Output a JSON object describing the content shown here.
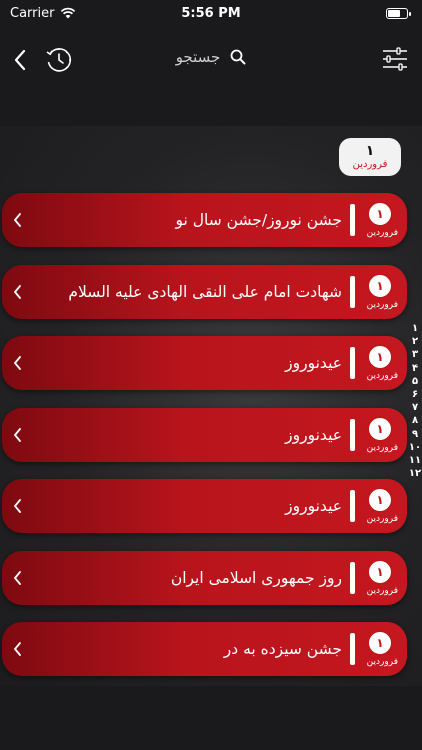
{
  "status_bar": {
    "carrier": "Carrier",
    "time": "5:56 PM"
  },
  "nav": {
    "search_label": "جستجو"
  },
  "date_chip": {
    "day": "۱",
    "month": "فروردین"
  },
  "events": [
    {
      "day": "۱",
      "month": "فروردین",
      "title": "جشن نوروز/جشن سال نو"
    },
    {
      "day": "۱",
      "month": "فروردین",
      "title": "شهادت امام علی النقی الهادی علیه السلام"
    },
    {
      "day": "۱",
      "month": "فروردین",
      "title": "عیدنوروز"
    },
    {
      "day": "۱",
      "month": "فروردین",
      "title": "عیدنوروز"
    },
    {
      "day": "۱",
      "month": "فروردین",
      "title": "عیدنوروز"
    },
    {
      "day": "۱",
      "month": "فروردین",
      "title": "روز جمهوری اسلامی ایران"
    },
    {
      "day": "۱",
      "month": "فروردین",
      "title": "جشن سیزده به در"
    }
  ],
  "month_index": [
    "۱",
    "۲",
    "۳",
    "۴",
    "۵",
    "۶",
    "۷",
    "۸",
    "۹",
    "۱۰",
    "۱۱",
    "۱۲"
  ],
  "colors": {
    "accent": "#c01818",
    "background": "#1a1a1c"
  },
  "icons": [
    "wifi-icon",
    "battery-icon",
    "back-chevron-icon",
    "history-clock-icon",
    "search-icon",
    "filter-sliders-icon",
    "chevron-left-icon"
  ]
}
